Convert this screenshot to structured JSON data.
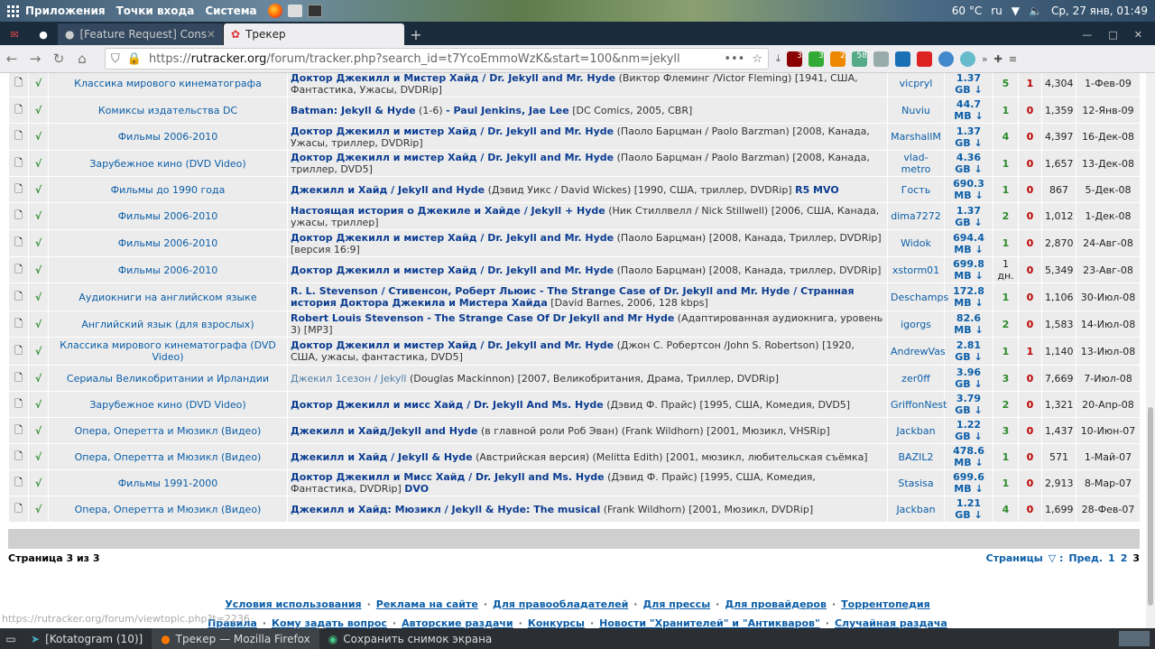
{
  "desktop": {
    "menu": [
      "Приложения",
      "Точки входа",
      "Система"
    ],
    "temp": "60 °C",
    "lang": "ru",
    "clock": "Ср, 27 янв, 01:49"
  },
  "tabs": [
    {
      "label": "[Feature Request] Conside"
    },
    {
      "label": "Трекер"
    }
  ],
  "address": {
    "prefix": "https://",
    "domain": "rutracker.org",
    "path": "/forum/tracker.php?search_id=t7YcoEmmoWzK&start=100&nm=jekyll"
  },
  "badges": {
    "b1": "3",
    "b2": "3",
    "b3": "2",
    "b4": "58"
  },
  "rows": [
    {
      "forum": "Классика мирового кинематографа",
      "title": "Доктор Джекилл и Мистер Хайд / Dr. Jekyll and Mr. Hyde",
      "rest": " (Виктор Флеминг /Victor Fleming) [1941, США, Фантастика, Ужасы, DVDRip]",
      "author": "vicpryl",
      "size": "1.37 GB ↓",
      "seeds": "5",
      "leech": "1",
      "dl": "4,304",
      "date": "1-Фев-09"
    },
    {
      "forum": "Комиксы издательства DC",
      "title": "Batman: Jekyll & Hyde",
      "rest1": " (1-6) ",
      "title2": "- Paul Jenkins, Jae Lee",
      "rest": " [DC Comics, 2005, CBR]",
      "author": "Nuviu",
      "size": "44.7 MB ↓",
      "seeds": "1",
      "leech": "0",
      "dl": "1,359",
      "date": "12-Янв-09"
    },
    {
      "forum": "Фильмы 2006-2010",
      "title": "Доктор Джекилл и мистер Хайд / Dr. Jekyll and Mr. Hyde",
      "rest": " (Паоло Барцман / Paolo Barzman) [2008, Канада, Ужасы, триллер, DVDRip]",
      "author": "MarshallM",
      "size": "1.37 GB ↓",
      "seeds": "4",
      "leech": "0",
      "dl": "4,397",
      "date": "16-Дек-08"
    },
    {
      "forum": "Зарубежное кино (DVD Video)",
      "title": "Доктор Джекилл и мистер Хайд / Dr. Jekyll and Mr. Hyde",
      "rest": " (Паоло Барцман / Paolo Barzman) [2008, Канада, триллер, DVD5]",
      "author": "vlad-metro",
      "size": "4.36 GB ↓",
      "seeds": "1",
      "leech": "0",
      "dl": "1,657",
      "date": "13-Дек-08"
    },
    {
      "forum": "Фильмы до 1990 года",
      "title": "Джекилл и Хайд / Jekyll and Hyde",
      "rest": " (Дэвид Уикс / David Wickes) [1990, США, триллер, DVDRip] ",
      "title2": "R5 MVO",
      "author": "Гость",
      "size": "690.3 MB ↓",
      "seeds": "1",
      "leech": "0",
      "dl": "867",
      "date": "5-Дек-08"
    },
    {
      "forum": "Фильмы 2006-2010",
      "title": "Настоящая история о Джекиле и Хайде / Jekyll + Hyde",
      "rest": " (Ник Стиллвелл / Nick Stillwell) [2006, США, Канада, ужасы, триллер]",
      "author": "dima7272",
      "size": "1.37 GB ↓",
      "seeds": "2",
      "leech": "0",
      "dl": "1,012",
      "date": "1-Дек-08"
    },
    {
      "forum": "Фильмы 2006-2010",
      "title": "Доктор Джекилл и мистер Хайд / Dr. Jekyll and Mr. Hyde",
      "rest": " (Паоло Барцман) [2008, Канада, Триллер, DVDRip] [версия 16:9]",
      "author": "Widok",
      "size": "694.4 MB ↓",
      "seeds": "1",
      "leech": "0",
      "dl": "2,870",
      "date": "24-Авг-08"
    },
    {
      "forum": "Фильмы 2006-2010",
      "title": "Доктор Джекилл и мистер Хайд / Dr. Jekyll and Mr. Hyde",
      "rest": " (Паоло Барцман) [2008, Канада, триллер, DVDRip]",
      "author": "xstorm01",
      "size": "699.8 MB ↓",
      "seeds": "1 дн.",
      "leech": "0",
      "dl": "5,349",
      "date": "23-Авг-08"
    },
    {
      "forum": "Аудиокниги на английском языке",
      "title": "R. L. Stevenson / Стивенсон, Роберт Льюис - The Strange Case of Dr. Jekyll and Mr. Hyde / Странная история Доктора Джекила и Мистера Хайда",
      "rest": " [David Barnes, 2006, 128 kbps]",
      "author": "Deschamps",
      "size": "172.8 MB ↓",
      "seeds": "1",
      "leech": "0",
      "dl": "1,106",
      "date": "30-Июл-08"
    },
    {
      "forum": "Английский язык (для взрослых)",
      "title": "Robert Louis Stevenson - The Strange Case Of Dr Jekyll and Mr Hyde",
      "rest": " (Адаптированная аудиокнига, уровень 3) [MP3]",
      "author": "igorgs",
      "size": "82.6 MB ↓",
      "seeds": "2",
      "leech": "0",
      "dl": "1,583",
      "date": "14-Июл-08"
    },
    {
      "forum": "Классика мирового кинематографа (DVD Video)",
      "title": "Доктор Джекилл и мистер Хайд / Dr. Jekyll and Mr. Hyde",
      "rest": " (Джон С. Робертсон /John S. Robertson) [1920, США, ужасы, фантастика, DVD5]",
      "author": "AndrewVas",
      "size": "2.81 GB ↓",
      "seeds": "1",
      "leech": "1",
      "dl": "1,140",
      "date": "13-Июл-08"
    },
    {
      "forum": "Сериалы Великобритании и Ирландии",
      "title": "Джекил 1сезон / Jekyll",
      "rest": " (Douglas Mackinnon) [2007, Великобритания, Драма, Триллер, DVDRip]",
      "author": "zer0ff",
      "size": "3.96 GB ↓",
      "seeds": "3",
      "leech": "0",
      "dl": "7,669",
      "date": "7-Июл-08",
      "gray": true
    },
    {
      "forum": "Зарубежное кино (DVD Video)",
      "title": "Доктор Джекилл и мисс Хайд / Dr. Jekyll And Ms. Hyde",
      "rest": " (Дэвид Ф. Прайс) [1995, США, Комедия, DVD5]",
      "author": "GriffonNest",
      "size": "3.79 GB ↓",
      "seeds": "2",
      "leech": "0",
      "dl": "1,321",
      "date": "20-Апр-08"
    },
    {
      "forum": "Опера, Оперетта и Мюзикл (Видео)",
      "title": "Джекилл и Хайд/Jekyll and Hyde",
      "rest": " (в главной роли Роб Эван) (Frank Wildhorn) [2001, Мюзикл, VHSRip]",
      "author": "Jackban",
      "size": "1.22 GB ↓",
      "seeds": "3",
      "leech": "0",
      "dl": "1,437",
      "date": "10-Июн-07"
    },
    {
      "forum": "Опера, Оперетта и Мюзикл (Видео)",
      "title": "Джекилл и Хайд / Jekyll & Hyde",
      "rest": " (Австрийская версия) (Melitta Edith) [2001, мюзикл, любительская съёмка]",
      "author": "BAZIL2",
      "size": "478.6 MB ↓",
      "seeds": "1",
      "leech": "0",
      "dl": "571",
      "date": "1-Май-07"
    },
    {
      "forum": "Фильмы 1991-2000",
      "title": "Доктор Джекилл и Мисс Хайд / Dr. Jekyll and Ms. Hyde",
      "rest": " (Дэвид Ф. Прайс) [1995, США, Комедия, Фантастика, DVDRip] ",
      "title2": "DVO",
      "author": "Stasisa",
      "size": "699.6 MB ↓",
      "seeds": "1",
      "leech": "0",
      "dl": "2,913",
      "date": "8-Мар-07"
    },
    {
      "forum": "Опера, Оперетта и Мюзикл (Видео)",
      "title": "Джекилл и Хайд: Мюзикл / Jekyll & Hyde: The musical",
      "rest": " (Frank Wildhorn) [2001, Мюзикл, DVDRip]",
      "author": "Jackban",
      "size": "1.21 GB ↓",
      "seeds": "4",
      "leech": "0",
      "dl": "1,699",
      "date": "28-Фев-07"
    }
  ],
  "pager": {
    "left": "Страница 3 из 3",
    "label": "Страницы",
    "prev": "Пред.",
    "p1": "1",
    "p2": "2",
    "p3": "3"
  },
  "footer": {
    "line1": [
      "Условия использования",
      "Реклама на сайте",
      "Для правообладателей",
      "Для прессы",
      "Для провайдеров",
      "Торрентопедия"
    ],
    "line2": [
      "Правила",
      "Кому задать вопрос",
      "Авторские раздачи",
      "Конкурсы",
      "Новости \"Хранителей\" и \"Антикваров\"",
      "Случайная раздача"
    ]
  },
  "status_url": "https://rutracker.org/forum/viewtopic.php?t=2236",
  "taskbar": [
    "[Kotatogram (10)]",
    "Трекер — Mozilla Firefox",
    "Сохранить снимок экрана"
  ]
}
